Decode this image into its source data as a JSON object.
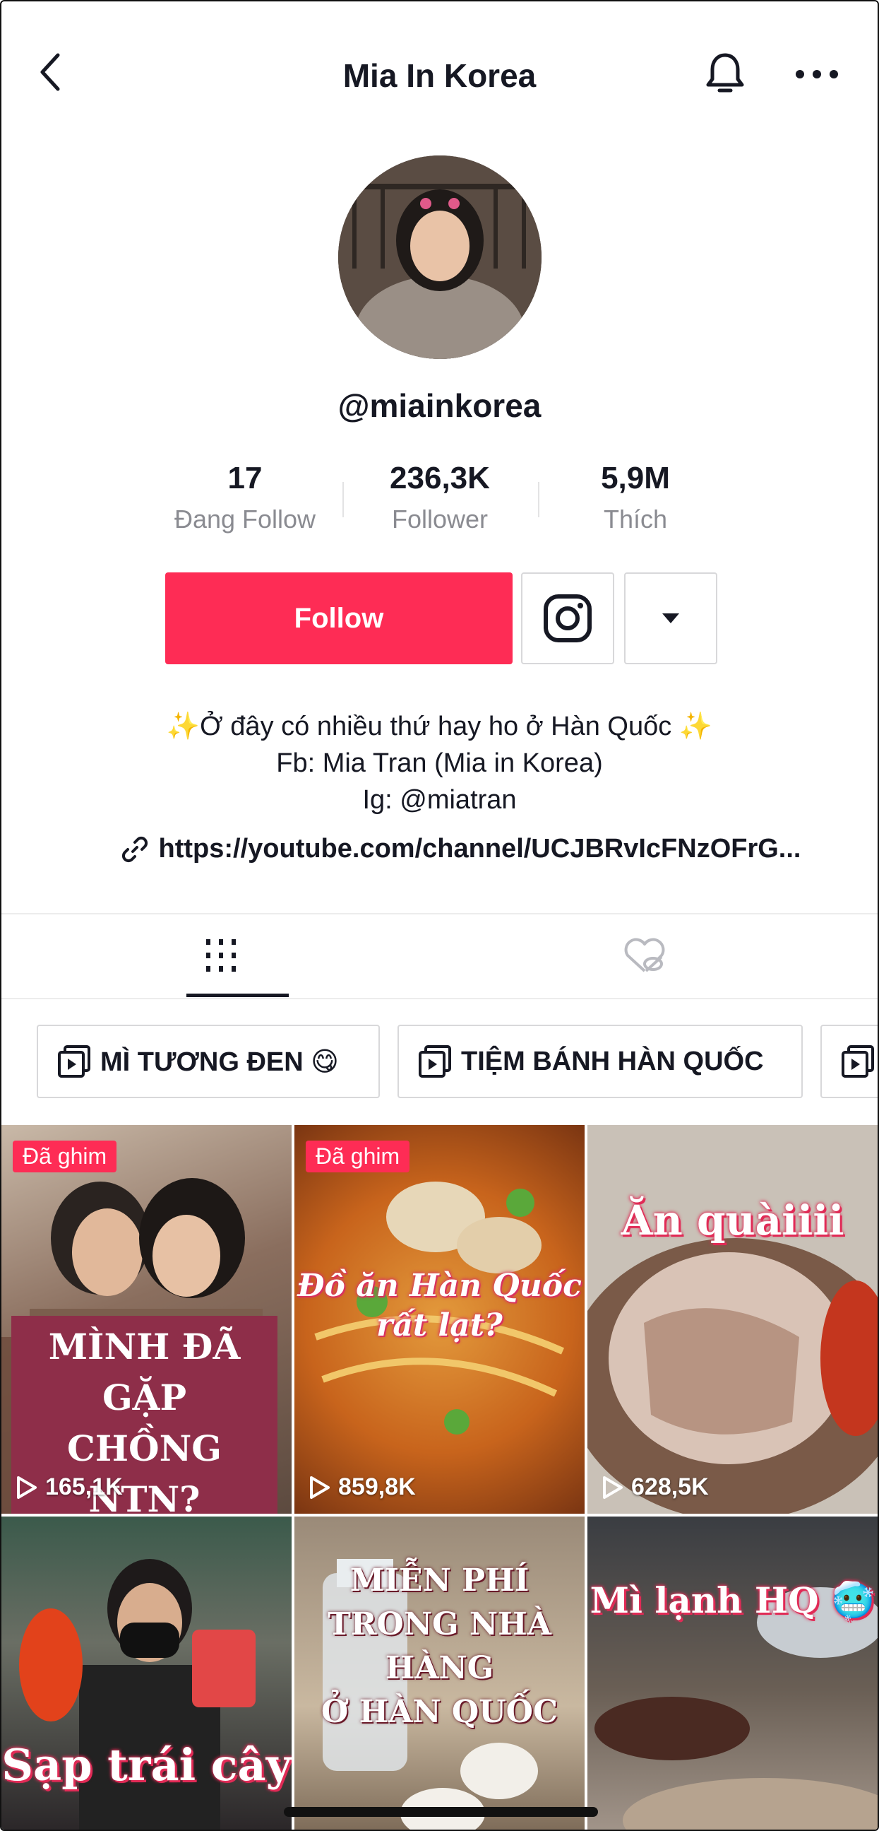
{
  "header": {
    "title": "Mia In Korea"
  },
  "profile": {
    "username": "@miainkorea"
  },
  "stats": [
    {
      "value": "17",
      "label": "Đang Follow"
    },
    {
      "value": "236,3K",
      "label": "Follower"
    },
    {
      "value": "5,9M",
      "label": "Thích"
    }
  ],
  "actions": {
    "follow_label": "Follow"
  },
  "bio": {
    "line1": "✨Ở đây có nhiều thứ hay ho ở Hàn Quốc ✨",
    "line2": "Fb: Mia Tran (Mia in Korea)",
    "line3": "Ig: @miatran",
    "link": "https://youtube.com/channel/UCJBRvIcFNzOFrG..."
  },
  "playlists": [
    {
      "label": "MÌ TƯƠNG ĐEN 😋"
    },
    {
      "label": "TIỆM BÁNH HÀN QUỐC"
    }
  ],
  "videos": [
    {
      "pinned": "Đã ghim",
      "views": "165,1K",
      "caption": "MÌNH ĐÃ GẶP\nCHỒNG NTN?"
    },
    {
      "pinned": "Đã ghim",
      "views": "859,8K",
      "caption": "Đồ ăn Hàn Quốc\nrất lạt?"
    },
    {
      "views": "628,5K",
      "caption": "Ăn quàiiii"
    },
    {
      "caption": "Sạp trái cây"
    },
    {
      "caption": "MIỄN PHÍ\nTRONG NHÀ HÀNG\nỞ HÀN QUỐC"
    },
    {
      "caption": "Mì lạnh HQ 🥶"
    }
  ],
  "colors": {
    "accent": "#fe2c55",
    "text": "#161823",
    "muted": "#8a8b91"
  }
}
